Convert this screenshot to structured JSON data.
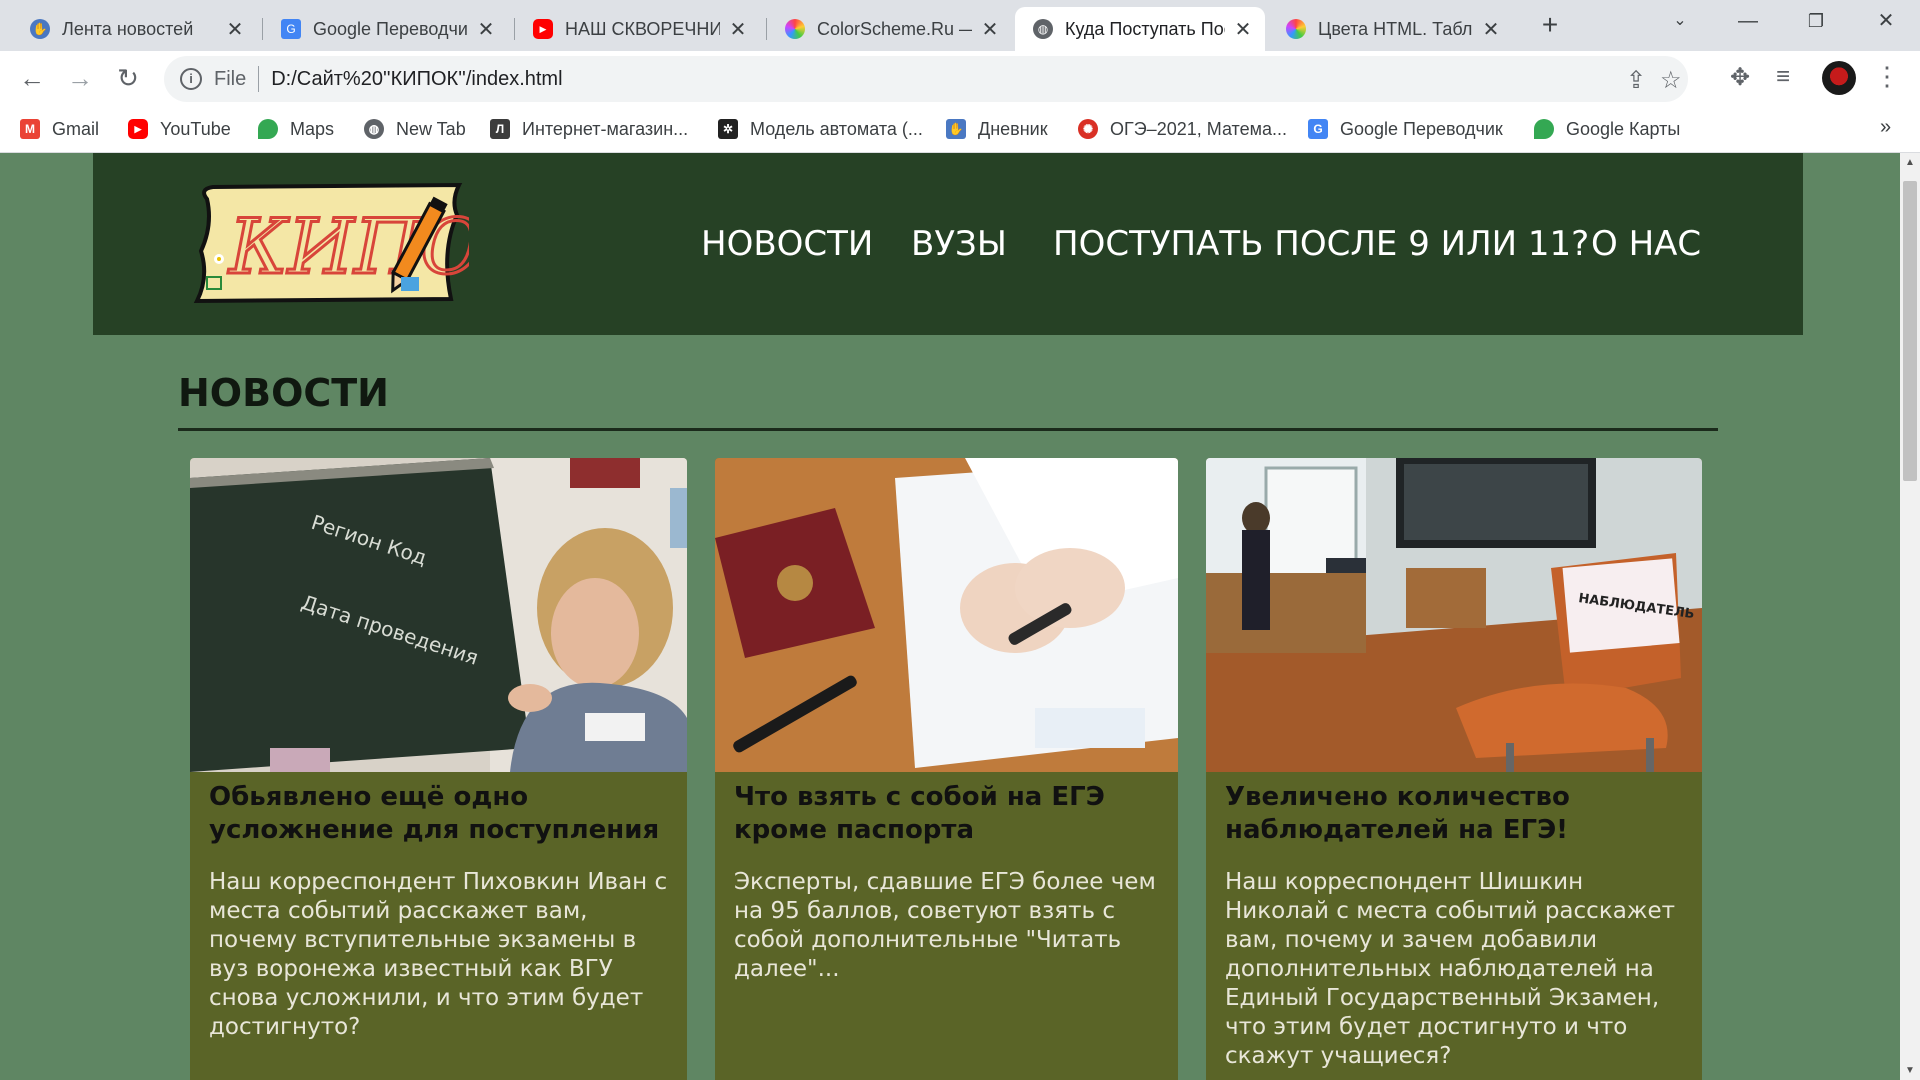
{
  "browser": {
    "tabs": [
      {
        "title": "Лента новостей",
        "icon": "dnevnik-icon",
        "color": "#4a78c2"
      },
      {
        "title": "Google Переводчик",
        "icon": "google-translate-icon",
        "color": "#4285f4"
      },
      {
        "title": "НАШ СКВОРЕЧНИК",
        "icon": "youtube-icon",
        "color": "#ff0000"
      },
      {
        "title": "ColorScheme.Ru — ",
        "icon": "color-wheel-icon",
        "color": "#b15fd0"
      },
      {
        "title": "Куда Поступать После",
        "icon": "globe-icon",
        "color": "#5f6368",
        "active": true
      },
      {
        "title": "Цвета HTML. Таблица",
        "icon": "color-wheel-icon",
        "color": "#d45fb0"
      }
    ],
    "address": {
      "scheme_label": "File",
      "url": "D:/Сайт%20''КИПОК''/index.html"
    },
    "bookmarks": [
      {
        "label": "Gmail",
        "icon": "gmail-icon",
        "color": "#ea4335"
      },
      {
        "label": "YouTube",
        "icon": "youtube-icon",
        "color": "#ff0000"
      },
      {
        "label": "Maps",
        "icon": "maps-icon",
        "color": "#34a853"
      },
      {
        "label": "New Tab",
        "icon": "globe-icon",
        "color": "#5f6368"
      },
      {
        "label": "Интернет-магазин...",
        "icon": "shop-icon",
        "color": "#3c3c3c"
      },
      {
        "label": "Модель автомата (...",
        "icon": "model-icon",
        "color": "#222222"
      },
      {
        "label": "Дневник",
        "icon": "dnevnik-icon",
        "color": "#4a78c2"
      },
      {
        "label": "ОГЭ–2021, Матема...",
        "icon": "oge-icon",
        "color": "#d93025"
      },
      {
        "label": "Google Переводчик",
        "icon": "google-translate-icon",
        "color": "#4285f4"
      },
      {
        "label": "Google Карты",
        "icon": "maps-icon",
        "color": "#34a853"
      }
    ]
  },
  "site": {
    "logo_text": "КИПОК",
    "nav": [
      "НОВОСТИ",
      "ВУЗЫ",
      "ПОСТУПАТЬ ПОСЛЕ 9 ИЛИ 11?",
      "О НАС"
    ],
    "section_title": "НОВОСТИ",
    "cards": [
      {
        "title": "Обьявлено ещё одно усложнение для поступления",
        "text": "Наш корреспондент Пиховкин Иван с места событий расскажет вам, почему вступительные экзамены в вуз воронежа известный как ВГУ снова усложнили, и что этим будет достигнуто?"
      },
      {
        "title": "Что взять с собой на ЕГЭ кроме паспорта",
        "text": "Эксперты, сдавшие ЕГЭ более чем на 95 баллов, советуют взять с собой дополнительные \"Читать далее\"..."
      },
      {
        "title": "Увеличено количество наблюдателей на ЕГЭ!",
        "text": "Наш корреспондент Шишкин Николай с места событий расскажет вам, почему и зачем добавили дополнительных наблюдателей на Единый Государственный Экзамен, что этим будет достигнуто и что скажут учащиеся?",
        "photo_sign": "НАБЛЮДАТЕЛЬ"
      }
    ]
  },
  "colors": {
    "page_bg": "#5f8663",
    "header_bg": "#264125",
    "card_bg": "#5a6427"
  }
}
